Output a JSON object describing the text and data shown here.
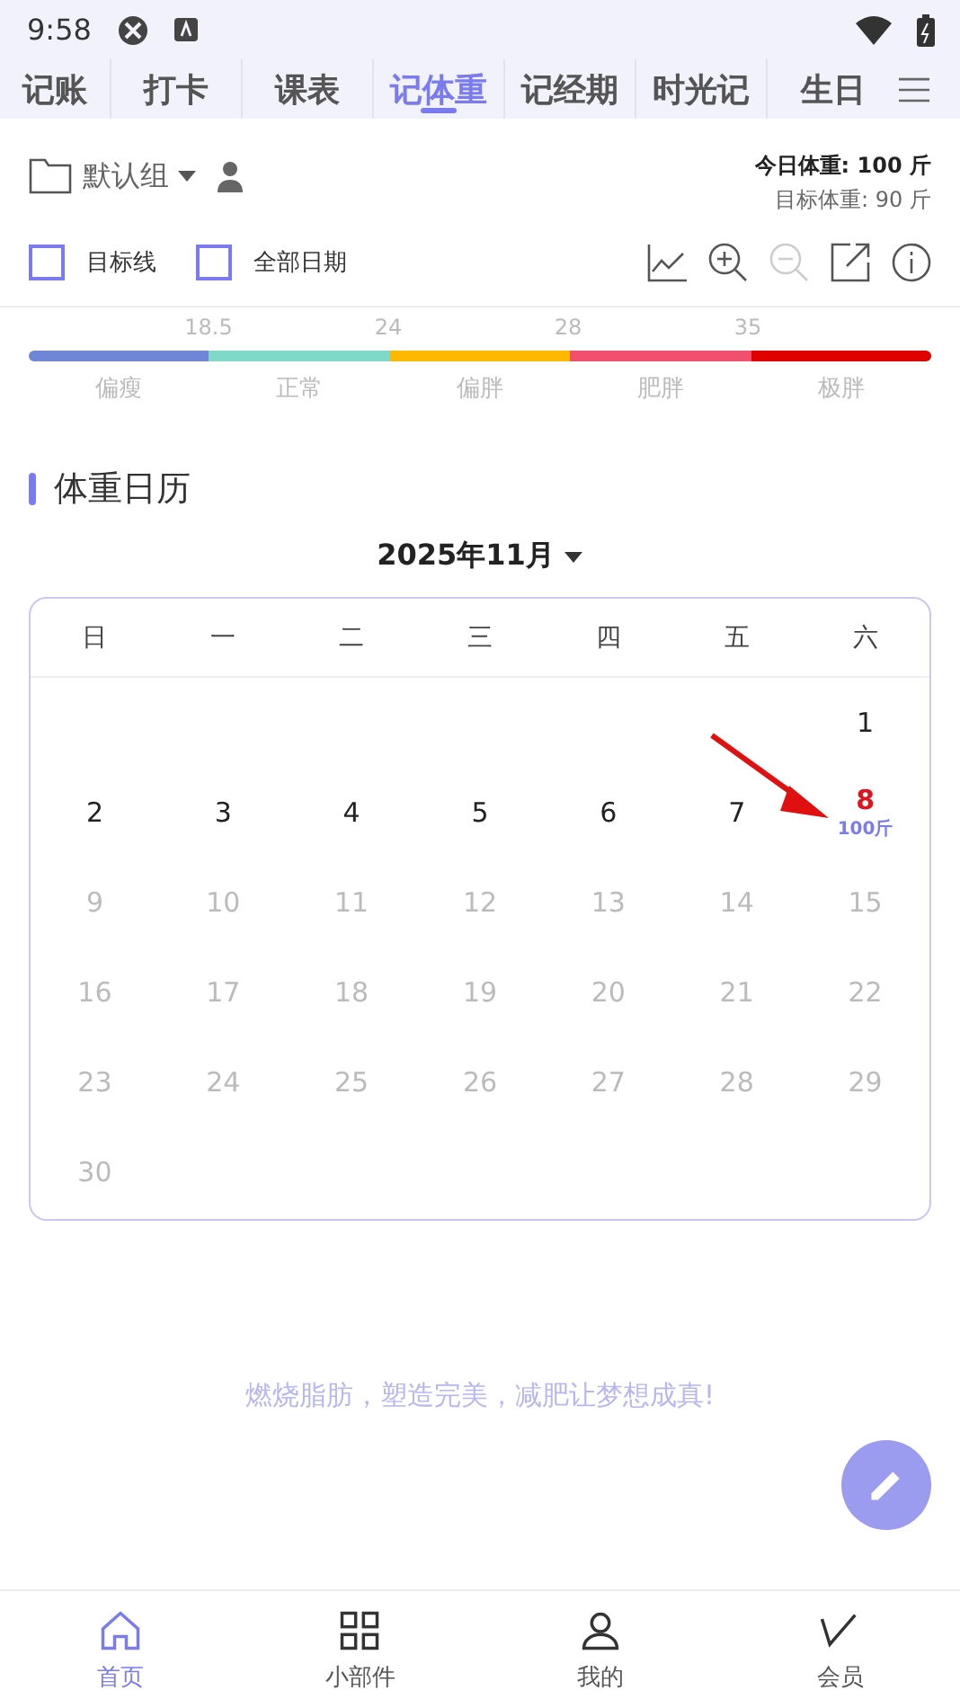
{
  "status_bar": {
    "time": "9:58"
  },
  "tabs": [
    {
      "label": "记账",
      "selected": false
    },
    {
      "label": "打卡",
      "selected": false
    },
    {
      "label": "课表",
      "selected": false
    },
    {
      "label": "记体重",
      "selected": true
    },
    {
      "label": "记经期",
      "selected": false
    },
    {
      "label": "时光记",
      "selected": false
    },
    {
      "label": "生日",
      "selected": false
    }
  ],
  "group": {
    "name": "默认组"
  },
  "today_weight": {
    "label": "今日体重:",
    "value": "100 斤"
  },
  "target_weight": "目标体重: 90 斤",
  "options": [
    {
      "label": "目标线",
      "checked": false
    },
    {
      "label": "全部日期",
      "checked": false
    }
  ],
  "bmi": {
    "ticks": [
      "18.5",
      "24",
      "28",
      "35"
    ],
    "segments": [
      {
        "label": "偏瘦",
        "color": "#6f86d6"
      },
      {
        "label": "正常",
        "color": "#7fd8c8"
      },
      {
        "label": "偏胖",
        "color": "#fcb900"
      },
      {
        "label": "肥胖",
        "color": "#f0506e"
      },
      {
        "label": "极胖",
        "color": "#e00000"
      }
    ]
  },
  "section_title": "体重日历",
  "calendar": {
    "month": "2025年11月",
    "weekdays": [
      "日",
      "一",
      "二",
      "三",
      "四",
      "五",
      "六"
    ],
    "days": [
      {
        "day": "1",
        "kind": "past"
      },
      {
        "day": "2",
        "kind": "past"
      },
      {
        "day": "3",
        "kind": "past"
      },
      {
        "day": "4",
        "kind": "past"
      },
      {
        "day": "5",
        "kind": "past"
      },
      {
        "day": "6",
        "kind": "past"
      },
      {
        "day": "7",
        "kind": "past"
      },
      {
        "day": "8",
        "kind": "today",
        "weight": "100斤"
      },
      {
        "day": "9",
        "kind": "future"
      },
      {
        "day": "10",
        "kind": "future"
      },
      {
        "day": "11",
        "kind": "future"
      },
      {
        "day": "12",
        "kind": "future"
      },
      {
        "day": "13",
        "kind": "future"
      },
      {
        "day": "14",
        "kind": "future"
      },
      {
        "day": "15",
        "kind": "future"
      },
      {
        "day": "16",
        "kind": "future"
      },
      {
        "day": "17",
        "kind": "future"
      },
      {
        "day": "18",
        "kind": "future"
      },
      {
        "day": "19",
        "kind": "future"
      },
      {
        "day": "20",
        "kind": "future"
      },
      {
        "day": "21",
        "kind": "future"
      },
      {
        "day": "22",
        "kind": "future"
      },
      {
        "day": "23",
        "kind": "future"
      },
      {
        "day": "24",
        "kind": "future"
      },
      {
        "day": "25",
        "kind": "future"
      },
      {
        "day": "26",
        "kind": "future"
      },
      {
        "day": "27",
        "kind": "future"
      },
      {
        "day": "28",
        "kind": "future"
      },
      {
        "day": "29",
        "kind": "future"
      },
      {
        "day": "30",
        "kind": "future"
      }
    ]
  },
  "slogan": "燃烧脂肪，塑造完美，减肥让梦想成真!",
  "bottom_nav": [
    {
      "label": "首页",
      "selected": true,
      "kind": "home"
    },
    {
      "label": "小部件",
      "selected": false,
      "kind": "widgets"
    },
    {
      "label": "我的",
      "selected": false,
      "kind": "profile"
    },
    {
      "label": "会员",
      "selected": false,
      "kind": "vip"
    }
  ]
}
